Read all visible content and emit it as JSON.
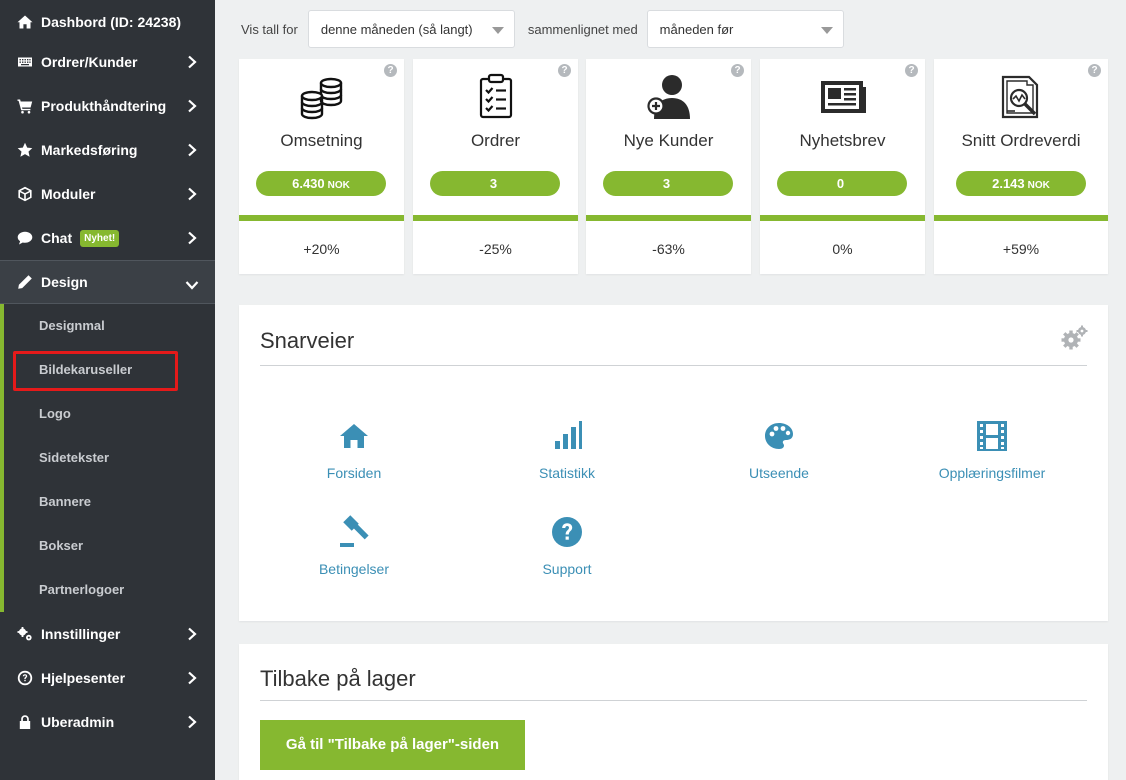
{
  "sidebar": {
    "items": [
      {
        "label": "Dashbord (ID: 24238)",
        "icon": "home-icon"
      },
      {
        "label": "Ordrer/Kunder",
        "icon": "keyboard-icon"
      },
      {
        "label": "Produkthåndtering",
        "icon": "cart-icon"
      },
      {
        "label": "Markedsføring",
        "icon": "star-icon"
      },
      {
        "label": "Moduler",
        "icon": "cube-icon"
      },
      {
        "label": "Chat",
        "icon": "chat-icon",
        "badge": "Nyhet!"
      },
      {
        "label": "Design",
        "icon": "pencil-icon"
      },
      {
        "label": "Innstillinger",
        "icon": "cogs-icon"
      },
      {
        "label": "Hjelpesenter",
        "icon": "question-icon"
      },
      {
        "label": "Uberadmin",
        "icon": "lock-icon"
      }
    ],
    "design_sub": [
      "Designmal",
      "Bildekaruseller",
      "Logo",
      "Sidetekster",
      "Bannere",
      "Bokser",
      "Partnerlogoer"
    ]
  },
  "filter": {
    "label_show": "Vis tall for",
    "period": "denne måneden (så langt)",
    "label_compare": "sammenlignet med",
    "compare": "måneden før"
  },
  "stats": [
    {
      "title": "Omsetning",
      "value": "6.430",
      "unit": "NOK",
      "change": "+20%",
      "icon": "coins-icon"
    },
    {
      "title": "Ordrer",
      "value": "3",
      "unit": "",
      "change": "-25%",
      "icon": "clipboard-icon"
    },
    {
      "title": "Nye Kunder",
      "value": "3",
      "unit": "",
      "change": "-63%",
      "icon": "add-user-icon"
    },
    {
      "title": "Nyhetsbrev",
      "value": "0",
      "unit": "",
      "change": "0%",
      "icon": "newspaper-icon"
    },
    {
      "title": "Snitt Ordreverdi",
      "value": "2.143",
      "unit": "NOK",
      "change": "+59%",
      "icon": "report-icon"
    }
  ],
  "help_glyph": "?",
  "shortcuts": {
    "title": "Snarveier",
    "items": [
      {
        "label": "Forsiden",
        "icon": "home-icon"
      },
      {
        "label": "Statistikk",
        "icon": "bar-chart-icon"
      },
      {
        "label": "Utseende",
        "icon": "palette-icon"
      },
      {
        "label": "Opplæringsfilmer",
        "icon": "film-icon"
      },
      {
        "label": "Betingelser",
        "icon": "gavel-icon"
      },
      {
        "label": "Support",
        "icon": "question-icon"
      }
    ]
  },
  "restock": {
    "title": "Tilbake på lager",
    "button": "Gå til \"Tilbake på lager\"-siden"
  },
  "colors": {
    "accent": "#86b830",
    "link": "#3b8fb5",
    "sidebar": "#2f3338",
    "highlight": "#e51a1a"
  }
}
